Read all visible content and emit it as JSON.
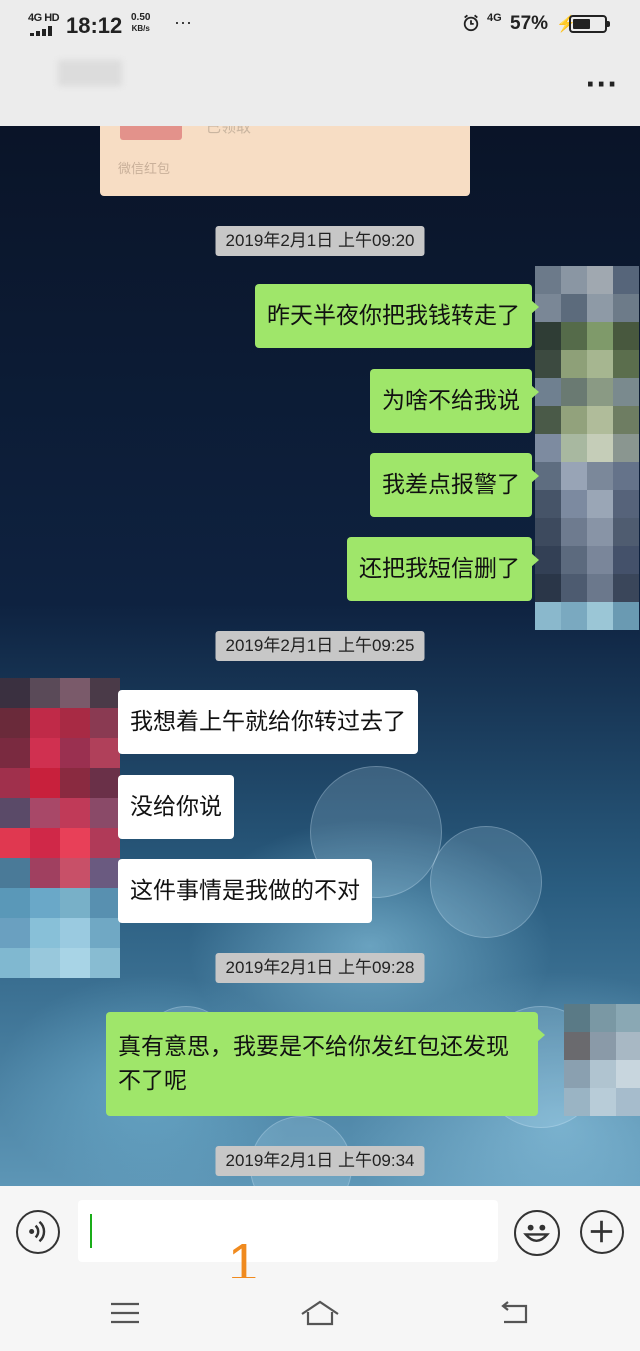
{
  "status_bar": {
    "network_type": "4G HD",
    "time": "18:12",
    "speed_value": "0.50",
    "speed_unit": "KB/s",
    "more_dots": "···",
    "data_label": "4G",
    "battery_percent": "57%",
    "battery_level": 0.57
  },
  "header": {
    "more_label": "···"
  },
  "red_packet": {
    "status": "已领取",
    "label": "微信红包"
  },
  "messages": [
    {
      "type": "timestamp",
      "text": "2019年2月1日 上午09:20"
    },
    {
      "type": "sent",
      "text": "昨天半夜你把我钱转走了"
    },
    {
      "type": "sent",
      "text": "为啥不给我说"
    },
    {
      "type": "sent",
      "text": "我差点报警了"
    },
    {
      "type": "sent",
      "text": "还把我短信删了"
    },
    {
      "type": "timestamp",
      "text": "2019年2月1日 上午09:25"
    },
    {
      "type": "received",
      "text": "我想着上午就给你转过去了"
    },
    {
      "type": "received",
      "text": "没给你说"
    },
    {
      "type": "received",
      "text": "这件事情是我做的不对"
    },
    {
      "type": "timestamp",
      "text": "2019年2月1日 上午09:28"
    },
    {
      "type": "sent",
      "text": "真有意思，我要是不给你发红包还发现不了呢"
    },
    {
      "type": "timestamp",
      "text": "2019年2月1日 上午09:34"
    }
  ],
  "input": {
    "value": "",
    "annotation": "1"
  },
  "colors": {
    "sent_bubble": "#9fe66a",
    "received_bubble": "#ffffff",
    "timestamp_bg": "#c7c7c7",
    "annotation": "#f08a1e"
  },
  "icons": [
    "voice-icon",
    "emoji-icon",
    "plus-icon",
    "menu-icon",
    "home-icon",
    "back-icon",
    "alarm-icon",
    "battery-icon",
    "charging-icon",
    "signal-icon"
  ]
}
